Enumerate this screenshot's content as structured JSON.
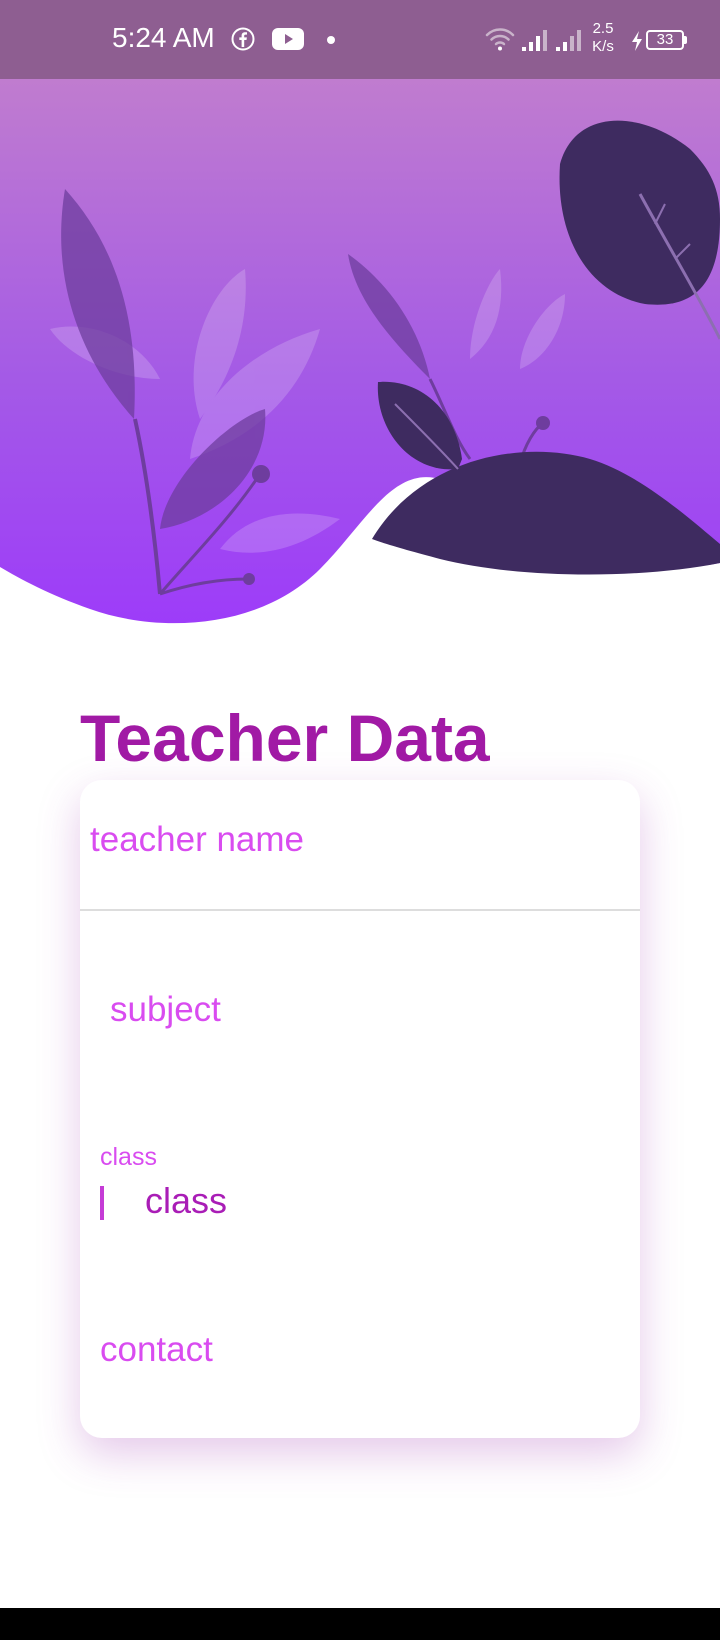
{
  "status_bar": {
    "time": "5:24 AM",
    "network_speed_value": "2.5",
    "network_speed_unit": "K/s",
    "battery": "33",
    "icons": [
      "facebook-icon",
      "youtube-icon",
      "notification-dot-icon",
      "wifi-icon",
      "signal-icon",
      "signal-icon",
      "charging-icon",
      "battery-icon"
    ]
  },
  "page": {
    "title": "Teacher Data"
  },
  "form": {
    "teacher_name_placeholder": "teacher name",
    "subject_placeholder": "subject",
    "class_floating_label": "class",
    "class_value": "class",
    "contact_placeholder": "contact"
  },
  "colors": {
    "status_bar": "#8e5e91",
    "hero_top": "#c07ccf",
    "hero_bottom": "#9d3cf9",
    "leaf_dark": "#3e2b60",
    "title": "#a11aa5",
    "placeholder": "#d94cf0",
    "input_text": "#a91db6"
  }
}
